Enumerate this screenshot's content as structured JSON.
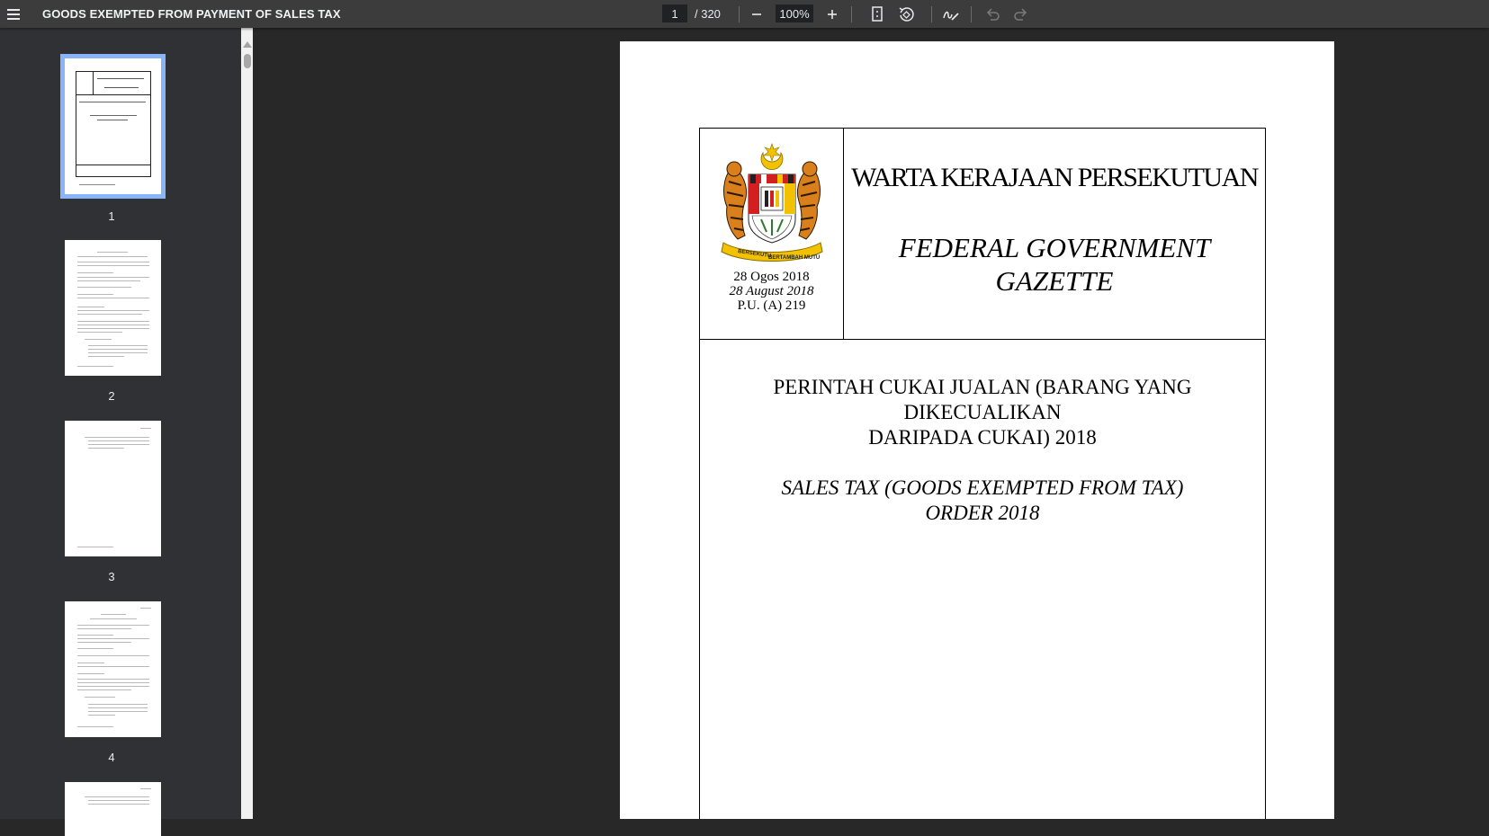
{
  "toolbar": {
    "title": "GOODS EXEMPTED FROM PAYMENT OF SALES TAX",
    "current_page": "1",
    "page_total": "/ 320",
    "zoom": "100%",
    "icons": [
      "menu-icon",
      "zoom-out-icon",
      "zoom-in-icon",
      "fit-page-icon",
      "rotate-icon",
      "annotate-icon",
      "undo-icon",
      "redo-icon"
    ]
  },
  "sidebar": {
    "thumbnails": [
      {
        "number": "1",
        "selected": true
      },
      {
        "number": "2",
        "selected": false
      },
      {
        "number": "3",
        "selected": false
      },
      {
        "number": "4",
        "selected": false
      }
    ]
  },
  "document": {
    "date_ms": "28 Ogos 2018",
    "date_en": "28 August 2018",
    "pu_number": "P.U. (A) 219",
    "gazette_title_ms": "WARTA KERAJAAN PERSEKUTUAN",
    "gazette_title_en_line1": "FEDERAL GOVERNMENT",
    "gazette_title_en_line2": "GAZETTE",
    "order_title_ms_line1": "PERINTAH CUKAI JUALAN (BARANG YANG DIKECUALIKAN",
    "order_title_ms_line2": "DARIPADA CUKAI) 2018",
    "order_title_en_line1": "SALES TAX (GOODS EXEMPTED FROM TAX)",
    "order_title_en_line2": "ORDER 2018",
    "crest_ribbon_left": "BERSEKUTU",
    "crest_ribbon_right": "BERTAMBAH MUTU"
  },
  "colors": {
    "toolbar_bg": "#3c3c3c",
    "sidebar_bg": "#303134",
    "viewer_bg": "#282828",
    "selection": "#8ab4f8"
  }
}
